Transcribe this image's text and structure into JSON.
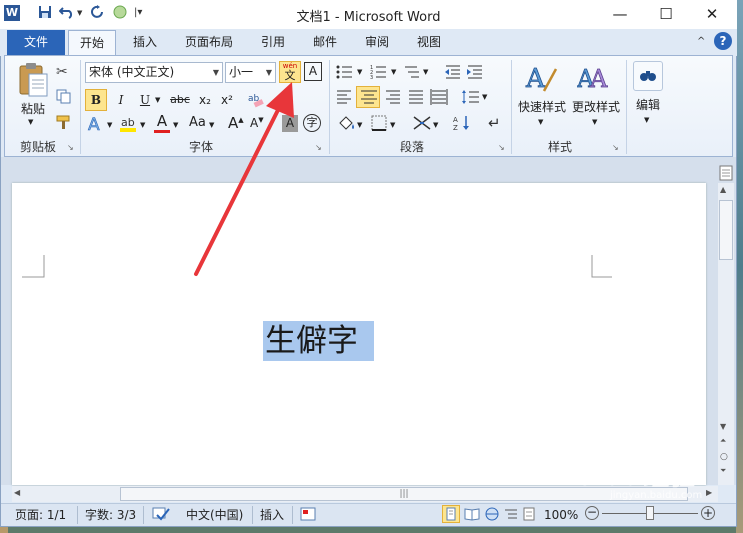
{
  "window": {
    "title": "文档1 - Microsoft Word"
  },
  "quick_access": {
    "app_icon": "W"
  },
  "ribbon_tabs": [
    {
      "label": "文件"
    },
    {
      "label": "开始"
    },
    {
      "label": "插入"
    },
    {
      "label": "页面布局"
    },
    {
      "label": "引用"
    },
    {
      "label": "邮件"
    },
    {
      "label": "审阅"
    },
    {
      "label": "视图"
    }
  ],
  "clipboard_group": {
    "label": "剪贴板",
    "paste_label": "粘贴"
  },
  "font_group": {
    "label": "字体",
    "font_name": "宋体 (中文正文)",
    "font_size": "小一",
    "phonetic_glyph": "wén",
    "phonetic_char": "文",
    "char_border": "A",
    "bold": "B",
    "italic": "I",
    "underline": "U",
    "strikethrough": "abc",
    "subscript": "x₂",
    "superscript": "x²",
    "font_color_letter": "A",
    "change_case": "Aa",
    "grow_font": "A",
    "shrink_font": "A",
    "char_shading": "A",
    "enclose_char": "字"
  },
  "paragraph_group": {
    "label": "段落"
  },
  "styles_group": {
    "label": "样式",
    "quick_styles_label": "快速样式",
    "change_styles_label": "更改样式"
  },
  "editing_group": {
    "label": "编辑"
  },
  "document": {
    "selected_text": "生僻字"
  },
  "status_bar": {
    "page": "页面: 1/1",
    "words": "字数: 3/3",
    "language": "中文(中国)",
    "insert_mode": "插入",
    "zoom": "100%"
  },
  "watermark": {
    "main": "Baidu经验",
    "sub": "jingyan.baidu.com"
  },
  "colors": {
    "file_tab": "#2b65b8",
    "selection": "#a9c8ee",
    "arrow": "#e8363a",
    "highlight_yellow": "#ffe600",
    "font_red": "#e02020"
  },
  "icons": [
    "word-app-icon",
    "save-icon",
    "undo-icon",
    "redo-icon",
    "circle-icon",
    "customize-icon",
    "minimize-icon",
    "maximize-icon",
    "close-icon",
    "help-icon",
    "cut-icon",
    "copy-icon",
    "format-painter-icon",
    "paste-icon",
    "clear-format-icon",
    "text-effects-icon",
    "highlight-icon",
    "bullets-icon",
    "numbering-icon",
    "multilevel-icon",
    "decrease-indent-icon",
    "increase-indent-icon",
    "align-left-icon",
    "align-center-icon",
    "align-right-icon",
    "justify-icon",
    "distributed-icon",
    "line-spacing-icon",
    "shading-icon",
    "borders-icon",
    "sort-icon",
    "show-marks-icon",
    "chinese-layout-icon",
    "quick-styles-icon",
    "change-styles-icon",
    "find-icon",
    "ruler-icon",
    "spell-check-icon",
    "print-layout-icon",
    "full-screen-icon",
    "web-layout-icon",
    "outline-icon",
    "draft-icon",
    "zoom-out-icon",
    "zoom-in-icon"
  ]
}
